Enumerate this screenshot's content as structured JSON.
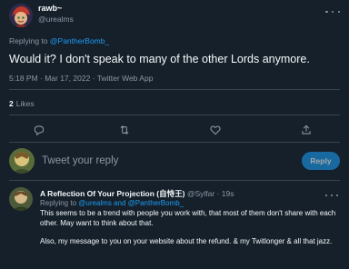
{
  "author": {
    "display_name": "rawb~",
    "handle": "@urealms",
    "avatar_icon": "avatar-character-icon"
  },
  "reply_context": {
    "prefix": "Replying to ",
    "mention": "@PantherBomb_"
  },
  "tweet": {
    "text": "Would it? I don't speak to many of the other Lords anymore.",
    "timestamp": "5:18 PM · Mar 17, 2022 · Twitter Web App"
  },
  "stats": {
    "likes_count": "2",
    "likes_label": "Likes"
  },
  "actions": [
    {
      "name": "reply-icon"
    },
    {
      "name": "retweet-icon"
    },
    {
      "name": "like-icon"
    },
    {
      "name": "share-icon"
    }
  ],
  "compose": {
    "placeholder": "Tweet your reply",
    "button_label": "Reply"
  },
  "reply": {
    "display_name": "A Reflection Of Your Projection (自恃王)",
    "handle_time": "@Sylfar · 19s",
    "replying_prefix": "Replying to ",
    "replying_mentions": "@urealms and @PantherBomb_",
    "body_line1": "This seems to be a trend with people you work with, that most of them don't share with each other. May want to think about that.",
    "body_line2": "Also, my message to you on your website about the refund. & my Twitlonger & all that jazz."
  },
  "colors": {
    "background": "#15202b",
    "text_primary": "#f7f9f9",
    "text_secondary": "#8b98a5",
    "accent": "#1d9bf0",
    "divider": "#38444d"
  }
}
